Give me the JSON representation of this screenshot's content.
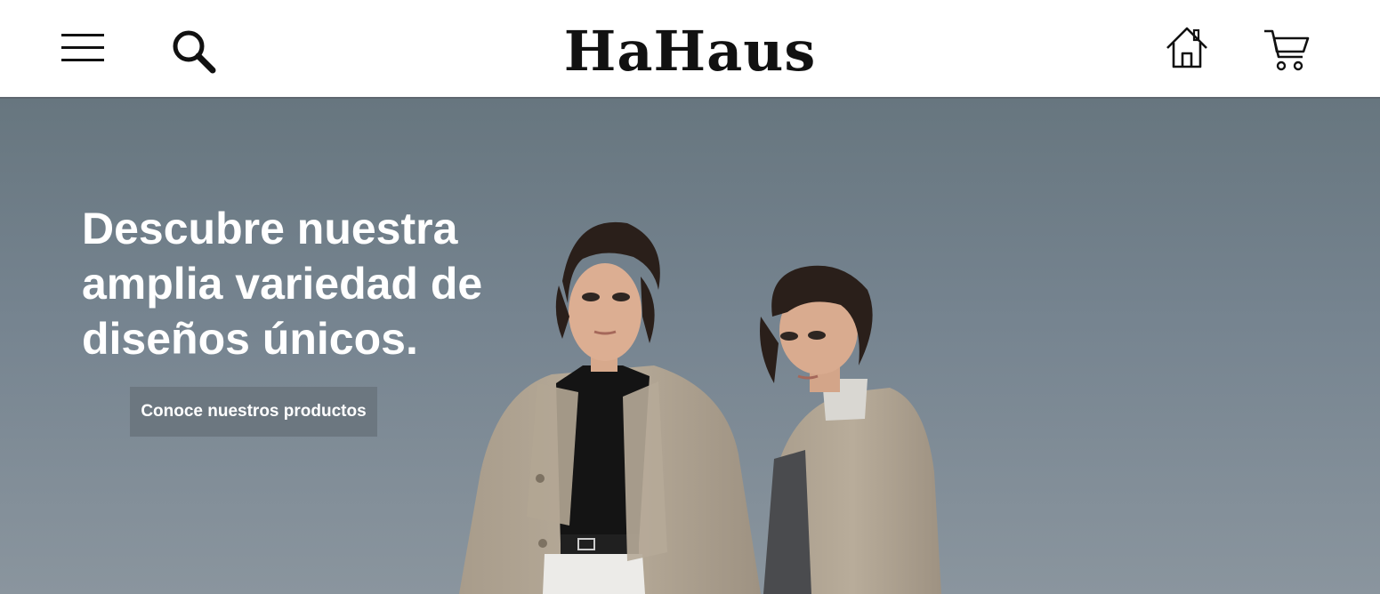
{
  "header": {
    "logo": "HaHaus",
    "icons": [
      "menu-icon",
      "search-icon",
      "home-icon",
      "cart-icon"
    ]
  },
  "hero": {
    "title": "Descubre nuestra amplia variedad de diseños únicos.",
    "cta_label": "Conoce nuestros productos"
  },
  "colors": {
    "sky_top": "#67767f",
    "sky_bottom": "#8a959e",
    "coat": "#b3a796",
    "text": "#111111",
    "cta_bg": "#6c7780"
  }
}
